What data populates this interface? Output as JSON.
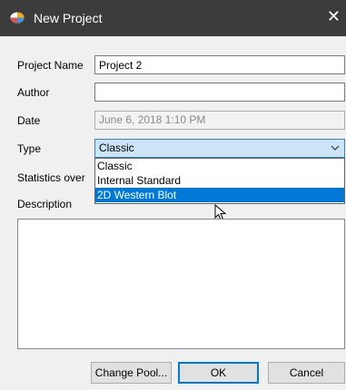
{
  "window": {
    "title": "New Project",
    "close_glyph": "✕"
  },
  "form": {
    "project_name": {
      "label": "Project Name",
      "value": "Project 2"
    },
    "author": {
      "label": "Author",
      "value": ""
    },
    "date": {
      "label": "Date",
      "value": "June 6, 2018 1:10 PM"
    },
    "type": {
      "label": "Type",
      "selected": "Classic",
      "options": [
        "Classic",
        "Internal Standard",
        "2D Western Blot"
      ],
      "highlighted": "2D Western Blot"
    },
    "statistics": {
      "label": "Statistics over"
    },
    "description": {
      "label": "Description",
      "value": ""
    }
  },
  "buttons": {
    "change_pool": "Change Pool...",
    "ok": "OK",
    "cancel": "Cancel"
  },
  "icons": {
    "app": "app-logo-icon",
    "close": "close-icon",
    "chevron": "chevron-down-icon",
    "cursor": "mouse-pointer-icon"
  },
  "colors": {
    "titlebar": "#3c3c3c",
    "accent": "#0078d7",
    "select_bg": "#cce4f7"
  }
}
